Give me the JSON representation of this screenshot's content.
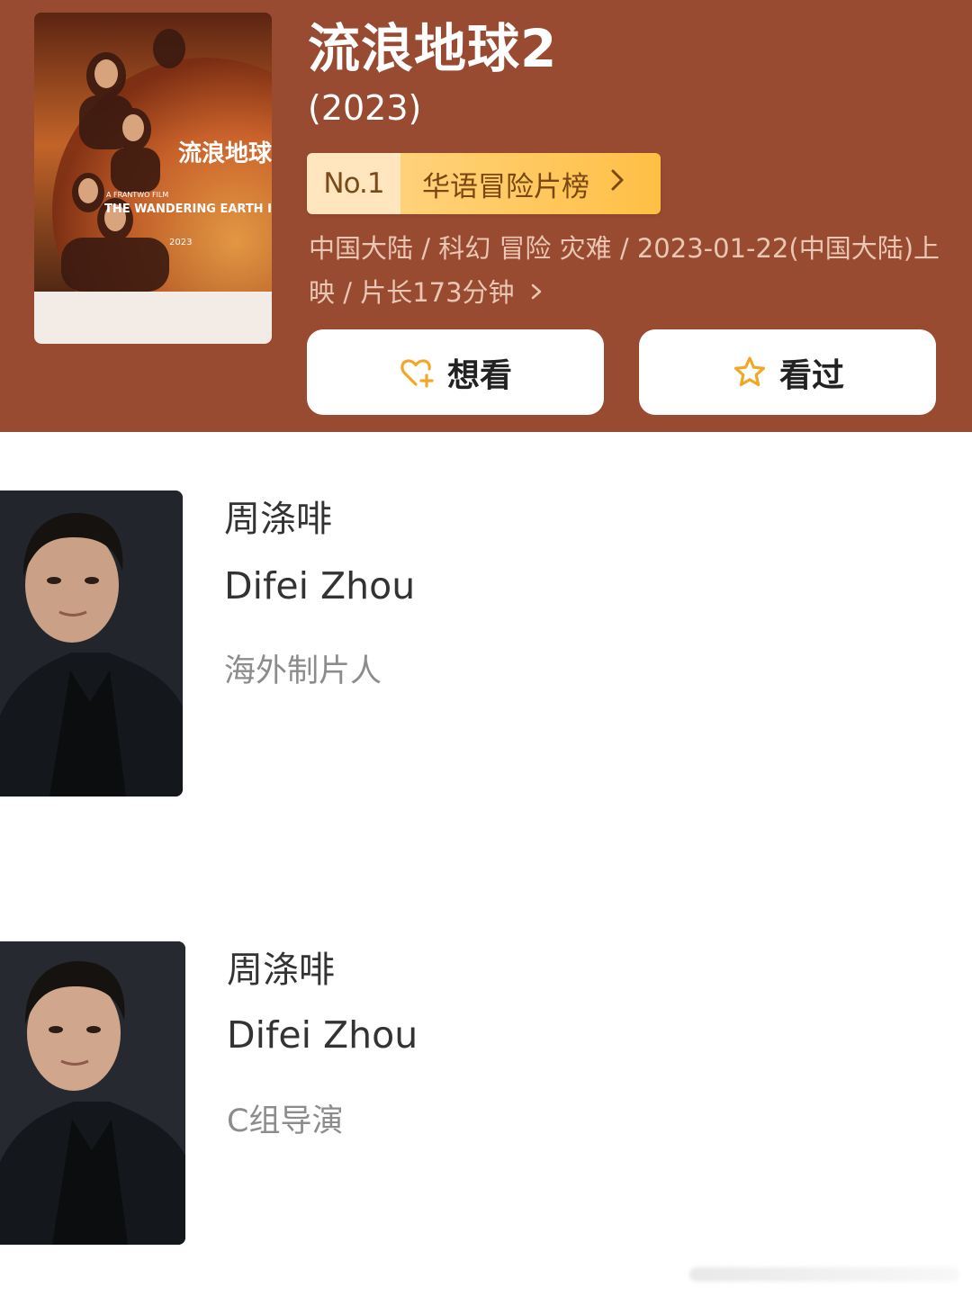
{
  "movie": {
    "title": "流浪地球2",
    "year": "(2023)",
    "rank": {
      "number": "No.1",
      "list_name": "华语冒险片榜",
      "chevron_icon": "chevron-right-icon"
    },
    "meta_line1": "中国大陆 / 科幻 冒险 灾难 / 2023-01-22(中国大陆)上",
    "meta_line2": "映 / 片长173分钟",
    "meta_chevron_icon": "chevron-right-icon",
    "poster": {
      "title_en": "THE WANDERING EARTH II",
      "title_cn": "流浪地球",
      "year": "2023",
      "studio": "A FRANTWO FILM"
    }
  },
  "actions": {
    "want": {
      "label": "想看",
      "icon": "heart-plus-icon"
    },
    "seen": {
      "label": "看过",
      "icon": "star-icon"
    }
  },
  "people": [
    {
      "name_cn": "周涤啡",
      "name_en": "Difei Zhou",
      "role": "海外制片人"
    },
    {
      "name_cn": "周涤啡",
      "name_en": "Difei Zhou",
      "role": "C组导演"
    }
  ],
  "colors": {
    "header_bg": "#984b30",
    "rank_no_bg": "#ffe6bf",
    "rank_label_bg": "#ffbf45",
    "icon_accent": "#f2a826",
    "meta_text": "#eac6b5"
  }
}
